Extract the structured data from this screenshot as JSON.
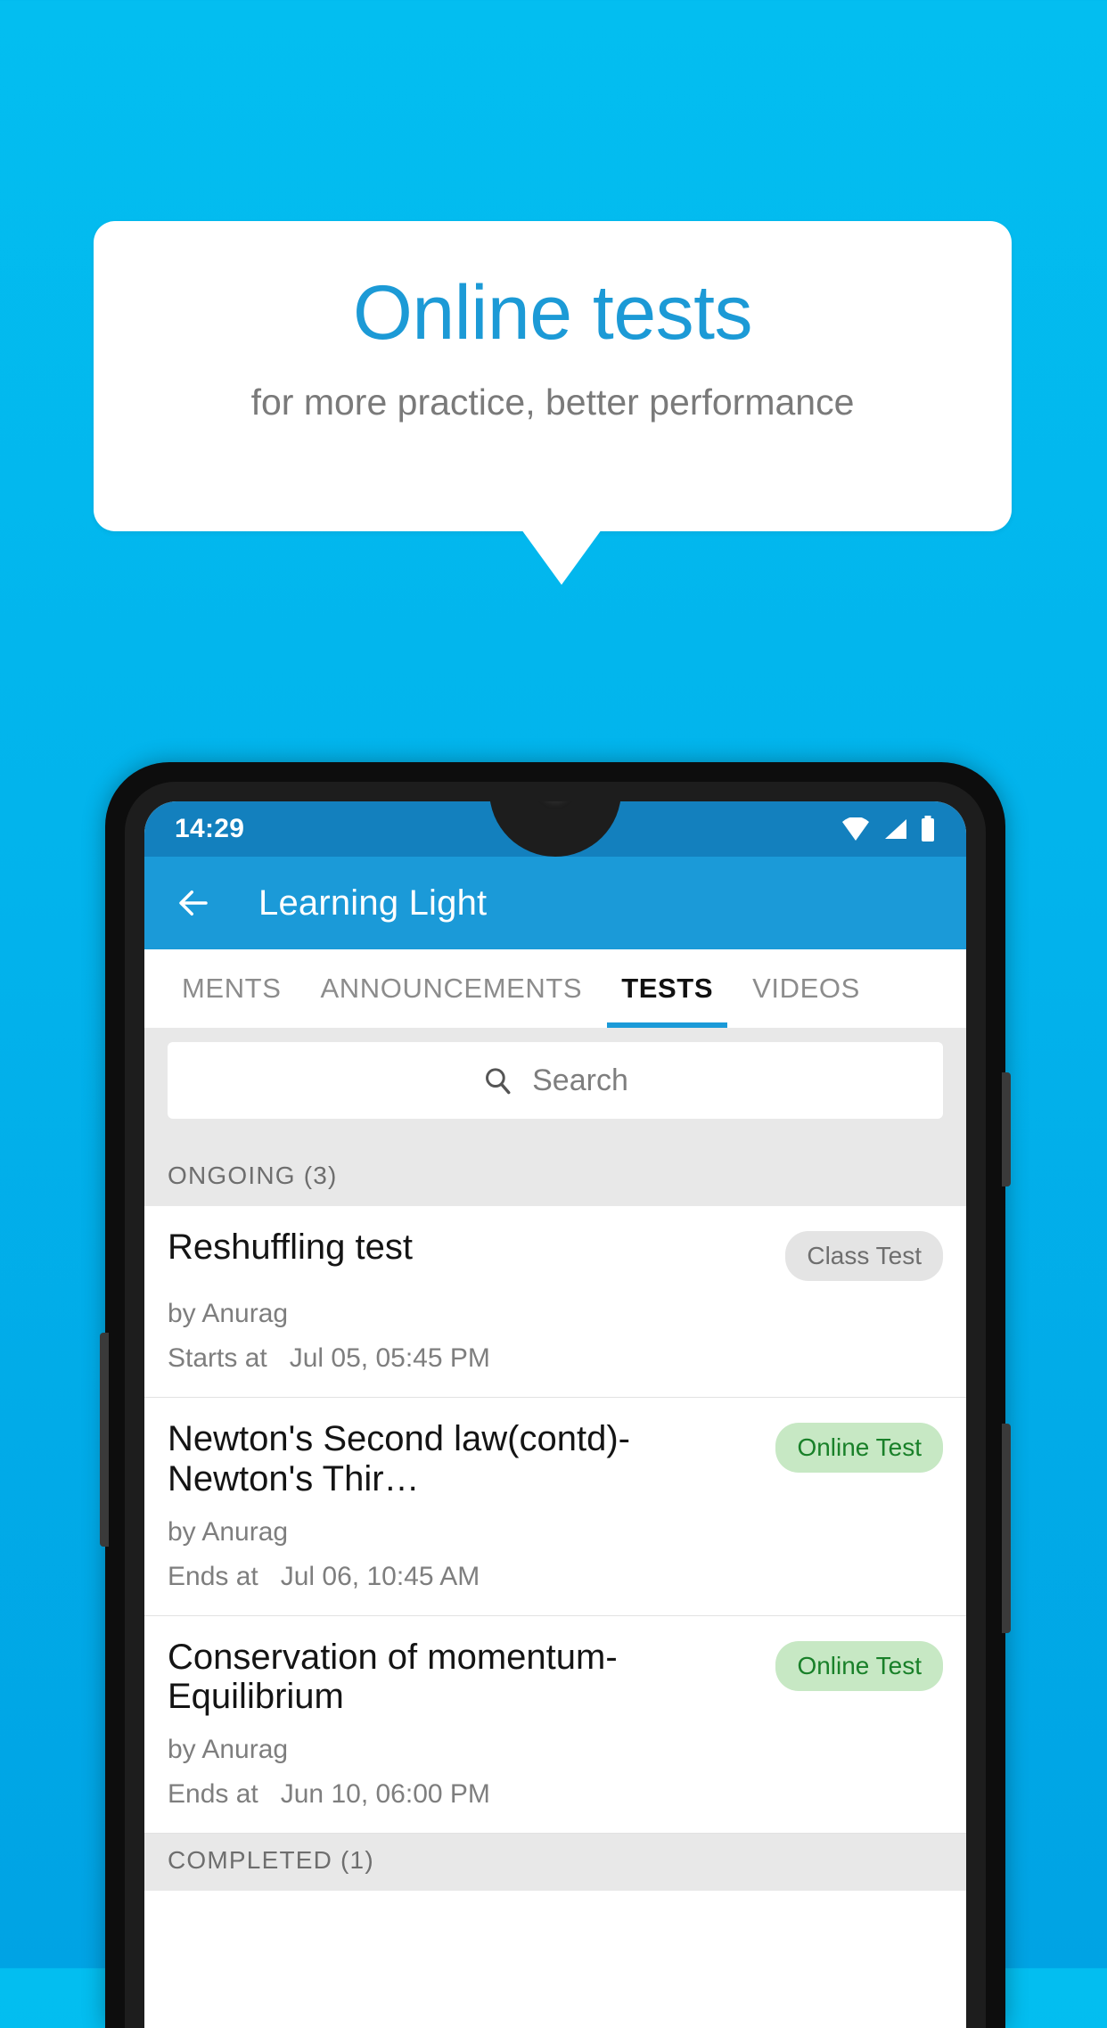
{
  "promo": {
    "title": "Online tests",
    "subtitle": "for more practice, better performance",
    "accent_color": "#1C9AD6"
  },
  "phone": {
    "status_bar": {
      "time": "14:29",
      "icons": [
        "wifi-icon",
        "signal-icon",
        "battery-icon"
      ],
      "background_color": "#1380BE"
    },
    "app_bar": {
      "back_icon": "back-arrow-icon",
      "title": "Learning Light",
      "background_color": "#1B9AD8"
    },
    "tabs": [
      {
        "label": "MENTS",
        "active": false
      },
      {
        "label": "ANNOUNCEMENTS",
        "active": false
      },
      {
        "label": "TESTS",
        "active": true
      },
      {
        "label": "VIDEOS",
        "active": false
      }
    ],
    "search": {
      "icon": "search-icon",
      "placeholder": "Search",
      "value": ""
    },
    "sections": [
      {
        "header": "ONGOING (3)",
        "items": [
          {
            "title": "Reshuffling test",
            "badge": "Class Test",
            "badge_type": "class",
            "author": "by Anurag",
            "time_label": "Starts at",
            "time_value": "Jul 05, 05:45 PM"
          },
          {
            "title": "Newton's Second law(contd)-Newton's Thir…",
            "badge": "Online Test",
            "badge_type": "online",
            "author": "by Anurag",
            "time_label": "Ends at",
            "time_value": "Jul 06, 10:45 AM"
          },
          {
            "title": "Conservation of momentum-Equilibrium",
            "badge": "Online Test",
            "badge_type": "online",
            "author": "by Anurag",
            "time_label": "Ends at",
            "time_value": "Jun 10, 06:00 PM"
          }
        ]
      },
      {
        "header": "COMPLETED (1)",
        "items": []
      }
    ]
  }
}
